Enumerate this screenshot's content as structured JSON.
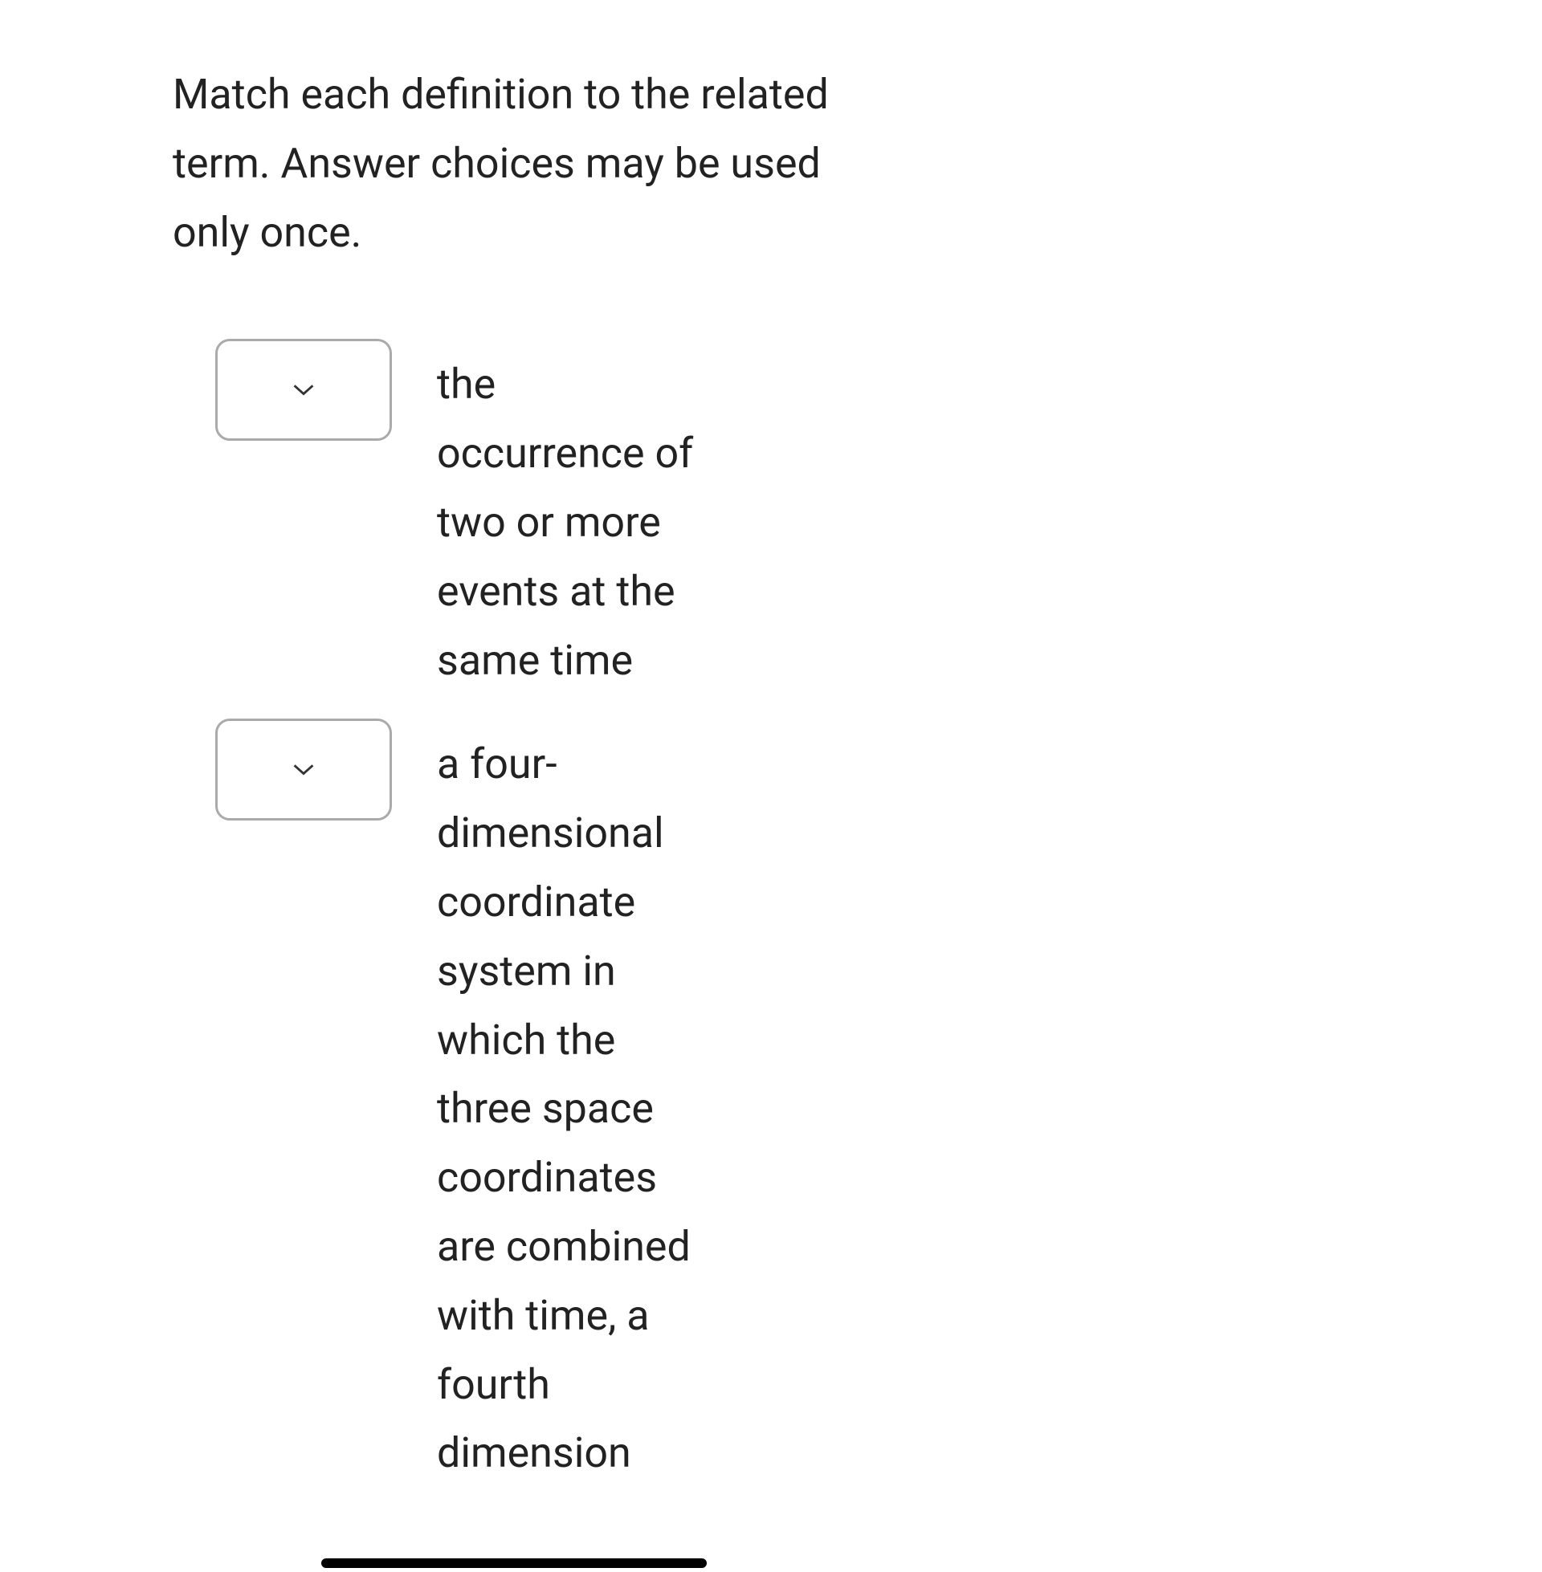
{
  "question": "Match each definition to the related term. Answer choices may be used only once.",
  "matches": [
    {
      "definition": "the occurrence of two or more events at the same time"
    },
    {
      "definition": "a four-dimensional coordinate system in which the three space coordinates are combined with time, a fourth dimension"
    }
  ]
}
